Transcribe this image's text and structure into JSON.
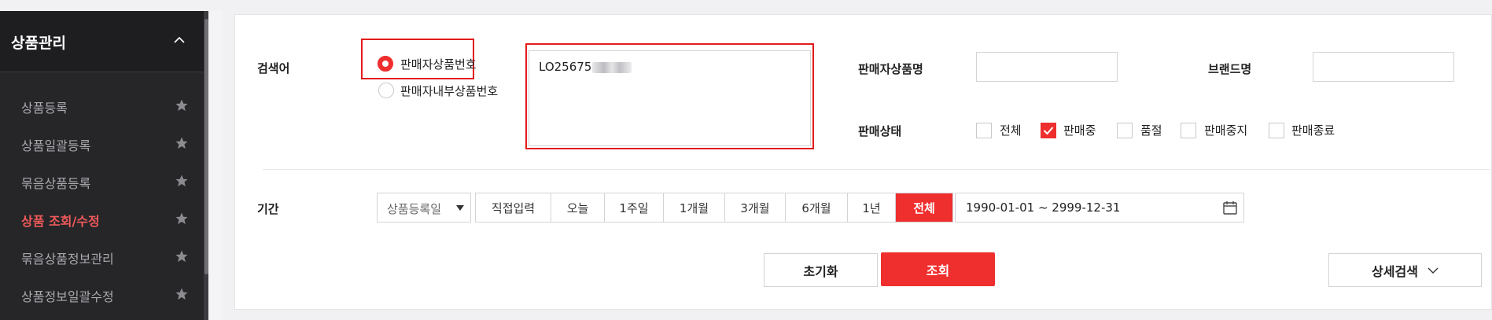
{
  "sidebar": {
    "title": "상품관리",
    "items": [
      {
        "label": "상품등록",
        "active": false
      },
      {
        "label": "상품일괄등록",
        "active": false
      },
      {
        "label": "묶음상품등록",
        "active": false
      },
      {
        "label": "상품 조회/수정",
        "active": true
      },
      {
        "label": "묶음상품정보관리",
        "active": false
      },
      {
        "label": "상품정보일괄수정",
        "active": false
      }
    ]
  },
  "search": {
    "keyword_label": "검색어",
    "radio_options": [
      {
        "label": "판매자상품번호",
        "checked": true
      },
      {
        "label": "판매자내부상품번호",
        "checked": false
      }
    ],
    "keyword_value": "LO25675",
    "product_name_label": "판매자상품명",
    "product_name_value": "",
    "brand_label": "브랜드명",
    "brand_value": "",
    "status_label": "판매상태",
    "status_options": [
      {
        "label": "전체",
        "checked": false
      },
      {
        "label": "판매중",
        "checked": true
      },
      {
        "label": "품절",
        "checked": false
      },
      {
        "label": "판매중지",
        "checked": false
      },
      {
        "label": "판매종료",
        "checked": false
      }
    ]
  },
  "period": {
    "label": "기간",
    "date_type": "상품등록일",
    "options": [
      {
        "label": "직접입력",
        "active": false
      },
      {
        "label": "오늘",
        "active": false
      },
      {
        "label": "1주일",
        "active": false
      },
      {
        "label": "1개월",
        "active": false
      },
      {
        "label": "3개월",
        "active": false
      },
      {
        "label": "6개월",
        "active": false
      },
      {
        "label": "1년",
        "active": false
      },
      {
        "label": "전체",
        "active": true
      }
    ],
    "date_range": "1990-01-01 ~ 2999-12-31"
  },
  "actions": {
    "reset_label": "초기화",
    "search_label": "조회",
    "detail_label": "상세검색"
  },
  "colors": {
    "accent": "#ef2e2e",
    "highlight": "#e21b1b",
    "sidebar_bg": "#262629",
    "active_menu": "#f15a5a"
  }
}
